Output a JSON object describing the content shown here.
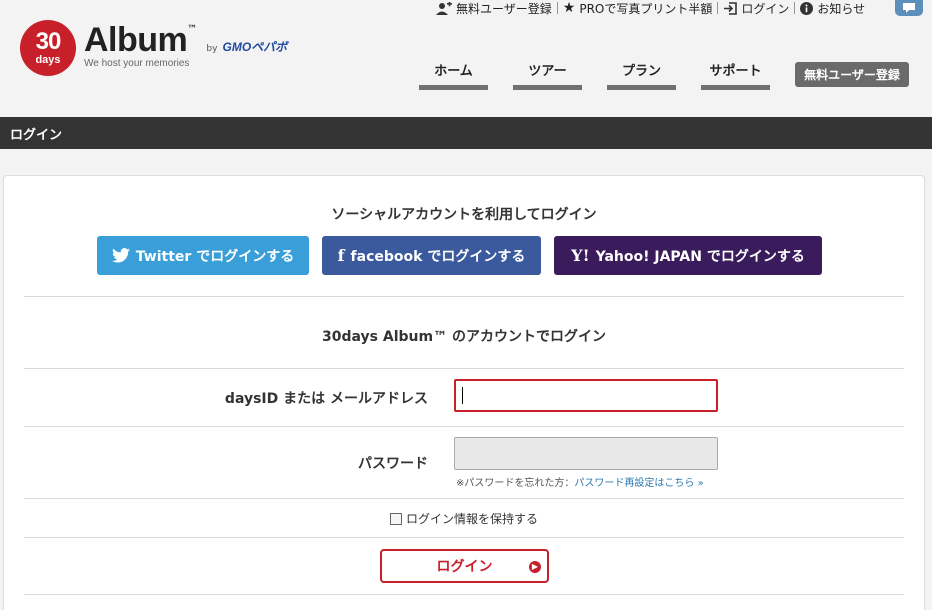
{
  "utility_bar": {
    "signup": "無料ユーザー登録",
    "pro_print": "PROで写真プリント半額",
    "login": "ログイン",
    "news": "お知らせ"
  },
  "logo": {
    "circle_number": "30",
    "circle_days": "days",
    "album": "Album",
    "trademark": "™",
    "by": "by",
    "gmo": "GMOペパボ",
    "tagline": "We host your memories"
  },
  "nav": {
    "items": [
      {
        "label": "ホーム"
      },
      {
        "label": "ツアー"
      },
      {
        "label": "プラン"
      },
      {
        "label": "サポート"
      }
    ],
    "signup_button": "無料ユーザー登録"
  },
  "page_title": "ログイン",
  "social": {
    "title": "ソーシャルアカウントを利用してログイン",
    "twitter": "Twitter でログインする",
    "facebook": "facebook でログインする",
    "yahoo": "Yahoo! JAPAN でログインする"
  },
  "account": {
    "title": "30days Album™ のアカウントでログイン",
    "id_label": "daysID または メールアドレス",
    "id_value": "",
    "password_label": "パスワード",
    "password_value": "",
    "forgot_prefix": "※パスワードを忘れた方：",
    "forgot_link": "パスワード再設定はこちら »",
    "remember_label": "ログイン情報を保持する",
    "remember_checked": false,
    "login_button": "ログイン"
  },
  "colors": {
    "brand_red": "#c8202a",
    "twitter": "#3a9fd8",
    "facebook": "#3b5a9d",
    "yahoo": "#3a1c5c",
    "title_bar": "#333333"
  }
}
